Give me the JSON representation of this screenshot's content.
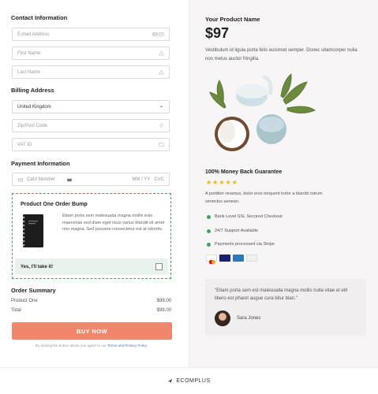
{
  "contact": {
    "title": "Contact Information",
    "email_placeholder": "E-mail Address",
    "first_name_placeholder": "First Name",
    "last_name_placeholder": "Last Name"
  },
  "billing": {
    "title": "Billing Address",
    "country_value": "United Kingdom",
    "zip_placeholder": "Zip/Post Code",
    "vat_placeholder": "VAT ID"
  },
  "payment": {
    "title": "Payment Information",
    "card_placeholder": "Card Number",
    "expiry_placeholder": "MM / YY",
    "cvc_placeholder": "CVC"
  },
  "bump": {
    "title": "Product One Order Bump",
    "text": "Etiam porta sem malesuada magna mollis euis maecenas sed diam eget risus varius blandit sit amet non magna. Sed posuere consectetur est at lobortis.",
    "take_label": "Yes, I'll take it!"
  },
  "summary": {
    "title": "Order Summary",
    "rows": [
      {
        "label": "Product One",
        "amount": "$99.00"
      },
      {
        "label": "Total",
        "amount": "$99.00"
      }
    ]
  },
  "buy_button": "BUY NOW",
  "terms": {
    "prefix": "By clicking the button above you agree to our ",
    "link": "Terms and Privacy Policy"
  },
  "product": {
    "name": "Your Product Name",
    "price": "$97",
    "description": "Vestibulum id ligula porta felis euismod semper. Donec ullamcorper nulla non metus auctor fringilla.",
    "rating": 5
  },
  "guarantee": {
    "title": "100% Money Back Guarantee",
    "text": "A porttitor vivamus, dolor eros torquent tortor a blandit rutrum senectus aenean."
  },
  "features": [
    "Bank Level SSL Secured Checkout",
    "24/7 Support Available",
    "Payments processed via Stripe"
  ],
  "payment_brands": [
    "mastercard",
    "visa",
    "amex",
    "paypal"
  ],
  "testimonial": {
    "quote": "\"Etiam porta sem est malesuada magna mollis nulla vitae et elit libero est pharet augue cura bitur blan.\"",
    "author": "Sara Jones"
  },
  "footer": {
    "brand": "ECOMPLUS"
  },
  "colors": {
    "accent": "#f0876c",
    "success": "#3aa65b",
    "right_panel_bg": "#f7f5f6"
  }
}
